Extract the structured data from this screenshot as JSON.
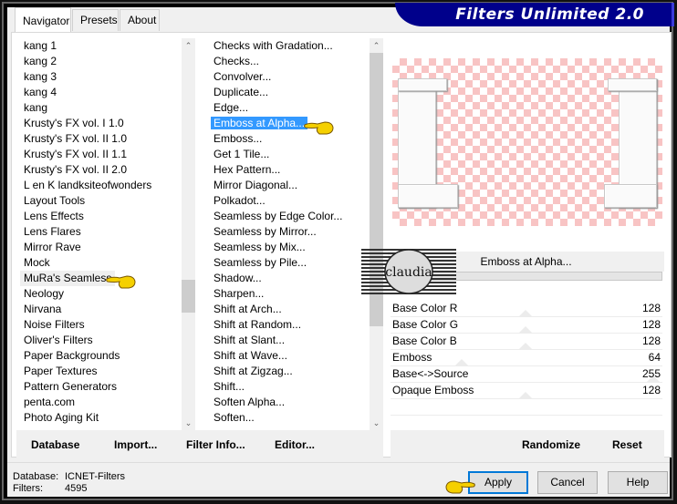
{
  "app": {
    "title": "Filters Unlimited 2.0"
  },
  "tabs": [
    {
      "label": "Navigator",
      "active": true
    },
    {
      "label": "Presets",
      "active": false
    },
    {
      "label": "About",
      "active": false
    }
  ],
  "categories": {
    "items": [
      "kang 1",
      "kang 2",
      "kang 3",
      "kang 4",
      "kang",
      "Krusty's FX vol. I 1.0",
      "Krusty's FX vol. II 1.0",
      "Krusty's FX vol. II 1.1",
      "Krusty's FX vol. II 2.0",
      "L en K landksiteofwonders",
      "Layout Tools",
      "Lens Effects",
      "Lens Flares",
      "Mirror Rave",
      "Mock",
      "MuRa's Seamless",
      "Neology",
      "Nirvana",
      "Noise Filters",
      "Oliver's Filters",
      "Paper Backgrounds",
      "Paper Textures",
      "Pattern Generators",
      "penta.com",
      "Photo Aging Kit"
    ],
    "selected": "MuRa's Seamless",
    "scroll_position": 0.62
  },
  "filters": {
    "items": [
      "Checks with Gradation...",
      "Checks...",
      "Convolver...",
      "Duplicate...",
      "Edge...",
      "Emboss at Alpha...",
      "Emboss...",
      "Get 1 Tile...",
      "Hex Pattern...",
      "Mirror Diagonal...",
      "Polkadot...",
      "Seamless by Edge Color...",
      "Seamless by Mirror...",
      "Seamless by Mix...",
      "Seamless by Pile...",
      "Shadow...",
      "Sharpen...",
      "Shift at Arch...",
      "Shift at Random...",
      "Shift at Slant...",
      "Shift at Wave...",
      "Shift at Zigzag...",
      "Shift...",
      "Soften Alpha...",
      "Soften..."
    ],
    "selected": "Emboss at Alpha...",
    "scroll_position": 0.0
  },
  "left_buttons": {
    "database": "Database",
    "import": "Import...",
    "filter_info": "Filter Info...",
    "editor": "Editor..."
  },
  "filter_panel": {
    "name": "Emboss at Alpha...",
    "params": [
      {
        "label": "Base Color R",
        "value": "128",
        "fraction": 0.5
      },
      {
        "label": "Base Color G",
        "value": "128",
        "fraction": 0.5
      },
      {
        "label": "Base Color B",
        "value": "128",
        "fraction": 0.5
      },
      {
        "label": "Emboss",
        "value": "64",
        "fraction": 0.25
      },
      {
        "label": "Base<->Source",
        "value": "255",
        "fraction": 1.0
      },
      {
        "label": "Opaque Emboss",
        "value": "128",
        "fraction": 0.5
      }
    ],
    "randomize": "Randomize",
    "reset": "Reset"
  },
  "status": {
    "database_label": "Database:",
    "database_value": "ICNET-Filters",
    "filters_label": "Filters:",
    "filters_value": "4595"
  },
  "dialog_buttons": {
    "apply": "Apply",
    "cancel": "Cancel",
    "help": "Help"
  },
  "watermark": {
    "text": "claudia"
  },
  "colors": {
    "brand_bg": "#00008b",
    "selection": "#3399ff",
    "checker_pink": "#f8c4c4",
    "default_button_border": "#0078d7"
  }
}
